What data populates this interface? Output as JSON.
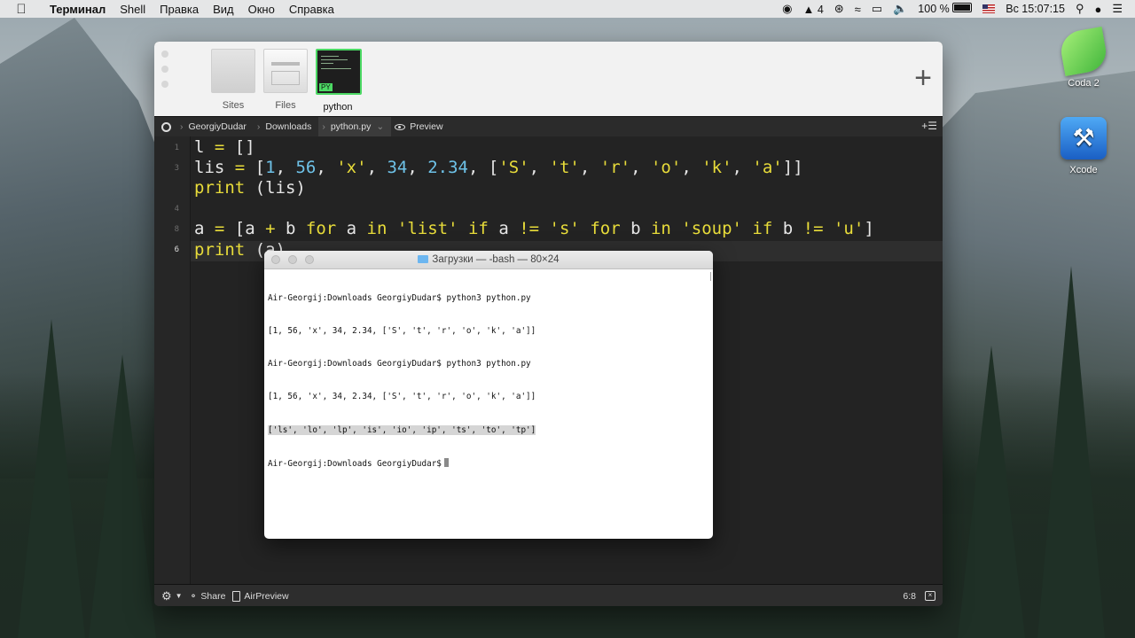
{
  "menubar": {
    "apple": "",
    "app_name": "Терминал",
    "items": [
      "Shell",
      "Правка",
      "Вид",
      "Окно",
      "Справка"
    ],
    "status": {
      "adobe_count": "4",
      "battery": "100 %",
      "clock": "Вс 15:07:15"
    }
  },
  "desktop": {
    "icons": [
      {
        "label": "Coda 2"
      },
      {
        "label": "Xcode"
      }
    ]
  },
  "coda": {
    "sites": [
      {
        "label": "Sites"
      },
      {
        "label": "Files"
      },
      {
        "label": "python",
        "tag": "PY"
      }
    ],
    "path": [
      "GeorgiyDudar",
      "Downloads",
      "python.py"
    ],
    "preview_label": "Preview",
    "lines": [
      {
        "num": "1"
      },
      {
        "num": "3"
      },
      {
        "num": ""
      },
      {
        "num": "4"
      },
      {
        "num": "8"
      },
      {
        "num": "6"
      }
    ],
    "status": {
      "share": "Share",
      "airpreview": "AirPreview",
      "position": "6:8"
    },
    "colors": {
      "keyword": "#e8dc3a",
      "number": "#6ec2e8",
      "background": "#232323"
    }
  },
  "terminal": {
    "title": "Загрузки — -bash — 80×24",
    "lines": [
      "Air-Georgij:Downloads GeorgiyDudar$ python3 python.py",
      "[1, 56, 'x', 34, 2.34, ['S', 't', 'r', 'o', 'k', 'a']]",
      "Air-Georgij:Downloads GeorgiyDudar$ python3 python.py",
      "[1, 56, 'x', 34, 2.34, ['S', 't', 'r', 'o', 'k', 'a']]",
      "['ls', 'lo', 'lp', 'is', 'io', 'ip', 'ts', 'to', 'tp']",
      "Air-Georgij:Downloads GeorgiyDudar$"
    ]
  }
}
